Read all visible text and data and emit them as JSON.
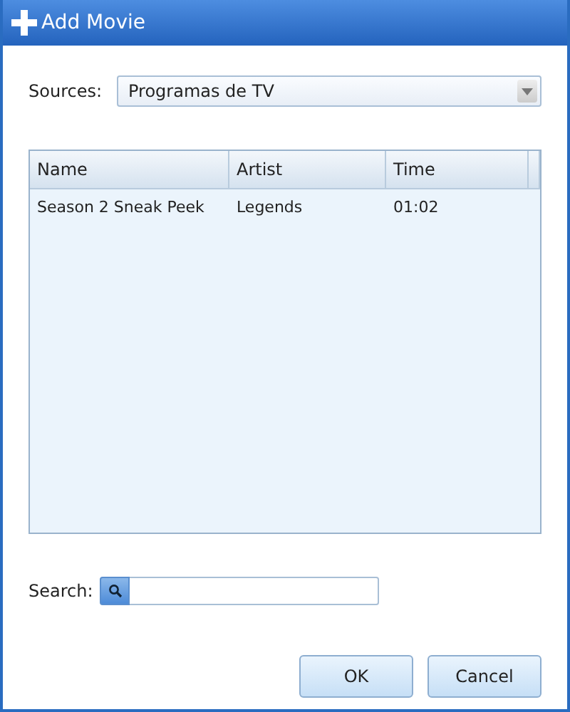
{
  "window": {
    "title": "Add Movie"
  },
  "sources": {
    "label": "Sources:",
    "value": "Programas de TV"
  },
  "table": {
    "columns": [
      "Name",
      "Artist",
      "Time"
    ],
    "rows": [
      {
        "cells": [
          "Season 2 Sneak Peek",
          "Legends",
          "01:02"
        ]
      }
    ]
  },
  "search": {
    "label": "Search:"
  },
  "buttons": [
    "OK",
    "Cancel"
  ]
}
